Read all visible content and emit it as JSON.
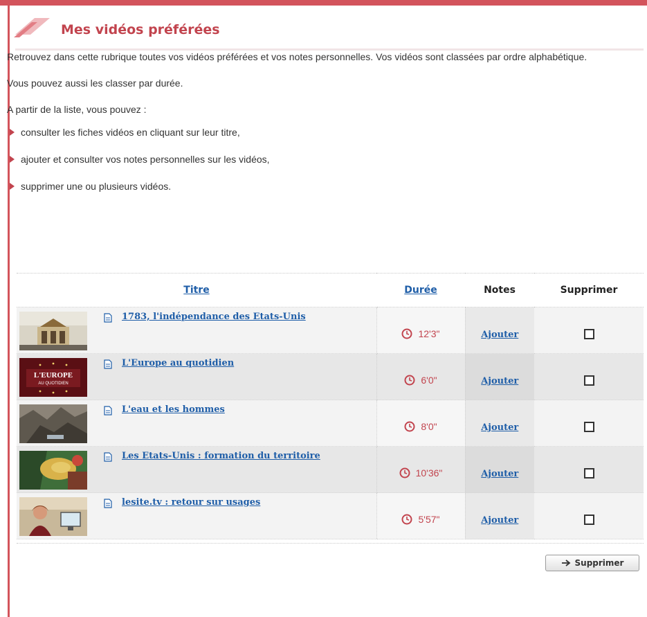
{
  "header": {
    "title": "Mes vidéos préférées"
  },
  "intro": {
    "paragraph1": "Retrouvez dans cette rubrique toutes vos vidéos préférées et vos notes personnelles. Vos vidéos sont classées par ordre alphabétique.",
    "paragraph2": "Vous pouvez aussi les classer par durée.",
    "paragraph3": "A partir de la liste, vous pouvez :",
    "bullets": [
      "consulter les fiches vidéos en cliquant sur leur titre,",
      "ajouter et consulter vos notes personnelles sur les vidéos,",
      "supprimer une ou plusieurs vidéos."
    ]
  },
  "table": {
    "headers": {
      "title": "Titre",
      "duration": "Durée",
      "notes": "Notes",
      "delete": "Supprimer"
    },
    "rows": [
      {
        "title": "1783, l'indépendance des Etats-Unis",
        "duration": "12'3\"",
        "notes": "Ajouter",
        "checked": false
      },
      {
        "title": "L'Europe au quotidien",
        "duration": "6'0\"",
        "notes": "Ajouter",
        "checked": false
      },
      {
        "title": "L'eau et les hommes",
        "duration": "8'0\"",
        "notes": "Ajouter",
        "checked": false
      },
      {
        "title": "Les Etats-Unis : formation du territoire",
        "duration": "10'36\"",
        "notes": "Ajouter",
        "checked": false
      },
      {
        "title": "lesite.tv : retour sur usages",
        "duration": "5'57\"",
        "notes": "Ajouter",
        "checked": false
      }
    ],
    "thumbnail_logo_lines": [
      "L'EUROPE",
      "AU QUOTIDIEN"
    ]
  },
  "actions": {
    "delete_button": "Supprimer"
  },
  "colors": {
    "accent": "#c2444e",
    "link": "#1f5ea8",
    "border": "#d3545c"
  },
  "icons": {
    "doc": "document-icon",
    "clock": "clock-icon",
    "bullet": "bullet-arrow-icon",
    "arrow": "arrow-right-icon"
  }
}
